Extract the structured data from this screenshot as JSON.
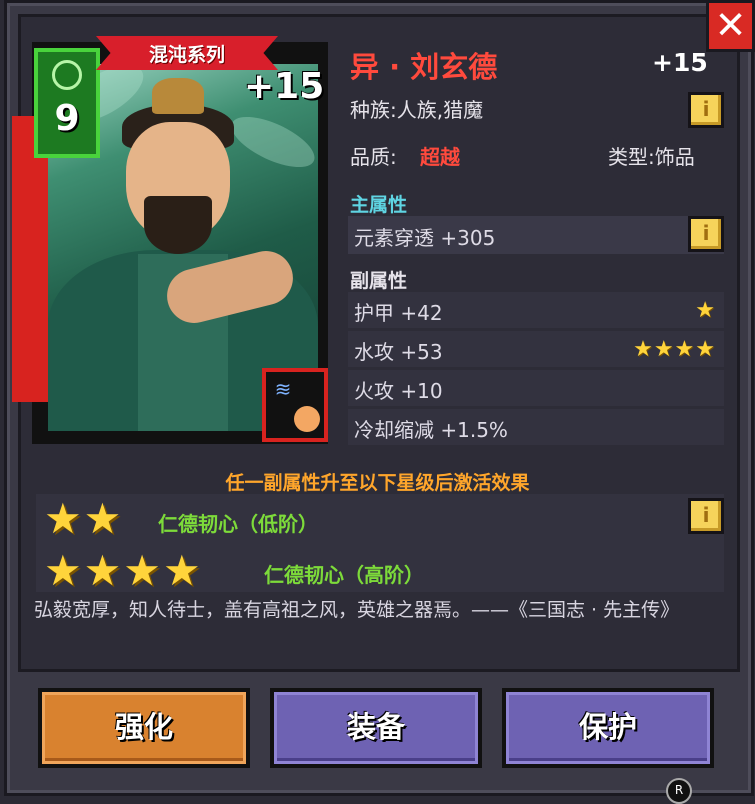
{
  "close_label": "✕",
  "card": {
    "series": "混沌系列",
    "plus": "+15",
    "cost": "9"
  },
  "item": {
    "name": "异 · 刘玄德",
    "level": "+15",
    "race": "种族:人族,猎魔",
    "quality_label": "品质:",
    "quality_value": "超越",
    "type": "类型:饰品"
  },
  "main_attr": {
    "label": "主属性",
    "value": "元素穿透 +305"
  },
  "sub_attr": {
    "label": "副属性",
    "rows": [
      {
        "text": "护甲 +42",
        "stars": "★"
      },
      {
        "text": "水攻 +53",
        "stars": "★★★★"
      },
      {
        "text": "火攻 +10",
        "stars": ""
      },
      {
        "text": "冷却缩减 +1.5%",
        "stars": ""
      }
    ]
  },
  "set_bonus": {
    "title": "任一副属性升至以下星级后激活效果",
    "low_stars": "★★",
    "low_text": "仁德韧心（低阶）",
    "high_stars": "★★★★",
    "high_text": "仁德韧心（高阶）"
  },
  "lore": "弘毅宽厚，知人待士，盖有高祖之风，英雄之器焉。——《三国志 · 先主传》",
  "buttons": {
    "enhance": "强化",
    "equip": "装备",
    "protect": "保护"
  },
  "badge_r": "R",
  "info_glyph": "i",
  "colors": {
    "name_red": "#ff4a3d",
    "main_attr_cyan": "#5fd5e3",
    "set_green": "#7ddb3a",
    "activate_orange": "#ffa62b",
    "enhance_button": "#d9822f",
    "action_button": "#6e62b3"
  }
}
